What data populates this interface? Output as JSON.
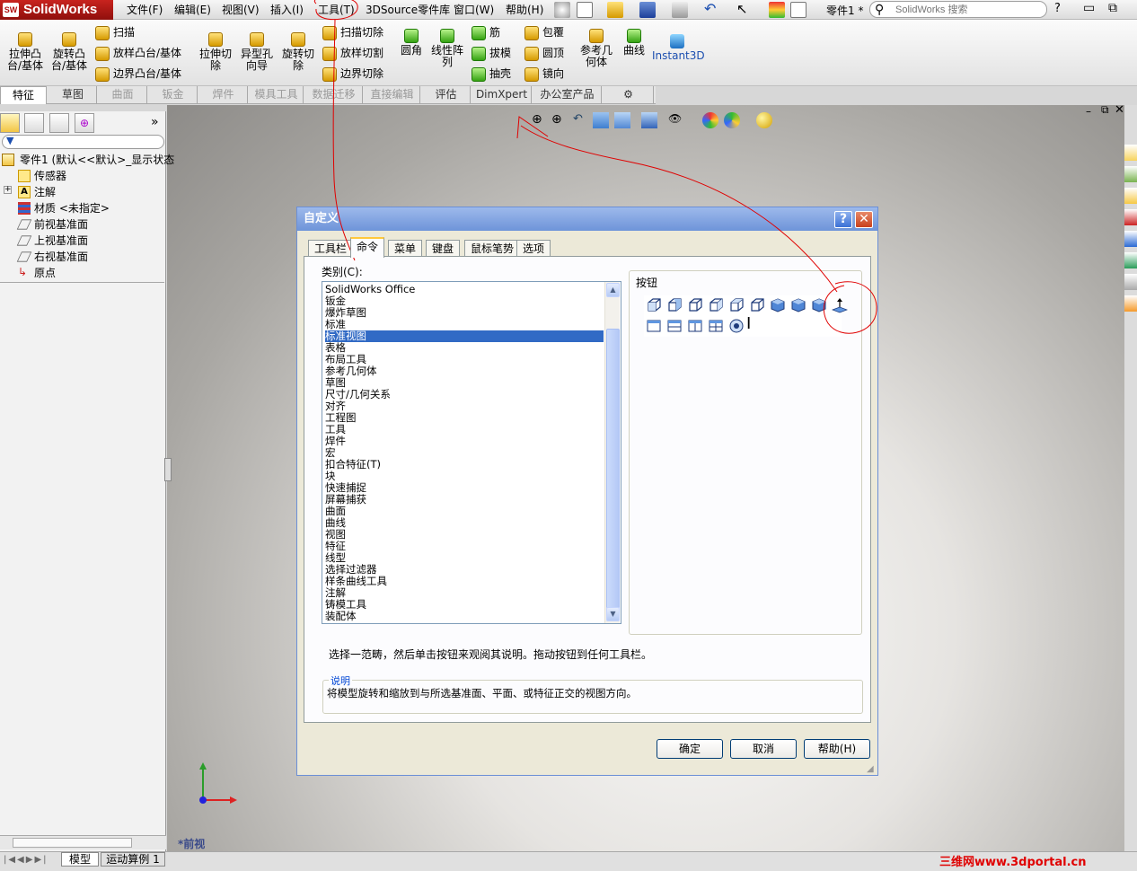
{
  "app": {
    "name": "SolidWorks",
    "doc_title": "零件1 *"
  },
  "menu": [
    "文件(F)",
    "编辑(E)",
    "视图(V)",
    "插入(I)",
    "工具(T)",
    "3DSource零件库",
    "窗口(W)",
    "帮助(H)"
  ],
  "search": {
    "placeholder": "SolidWorks 搜索"
  },
  "ribbon": {
    "extrude_boss": "拉伸凸\n台/基体",
    "revolve_boss": "旋转凸\n台/基体",
    "sweep": "扫描",
    "loft_boss": "放样凸台/基体",
    "boundary_boss": "边界凸台/基体",
    "extrude_cut": "拉伸切\n除",
    "hole_wizard": "异型孔\n向导",
    "revolve_cut": "旋转切\n除",
    "sweep_cut": "扫描切除",
    "loft_cut": "放样切割",
    "boundary_cut": "边界切除",
    "fillet": "圆角",
    "linear_pattern": "线性阵\n列",
    "rib": "筋",
    "draft": "拔模",
    "shell": "抽壳",
    "wrap": "包覆",
    "dome": "圆顶",
    "mirror": "镜向",
    "ref_geometry": "参考几\n何体",
    "curves": "曲线",
    "instant3d": "Instant3D"
  },
  "tabs": [
    "特征",
    "草图",
    "曲面",
    "钣金",
    "焊件",
    "模具工具",
    "数据迁移",
    "直接编辑",
    "评估",
    "DimXpert",
    "办公室产品"
  ],
  "tree": {
    "root": "零件1  (默认<<默认>_显示状态",
    "items": [
      "传感器",
      "注解",
      "材质 <未指定>",
      "前视基准面",
      "上视基准面",
      "右视基准面",
      "原点"
    ]
  },
  "viewport": {
    "view_label": "*前视"
  },
  "bottom_tabs": [
    "模型",
    "运动算例 1"
  ],
  "watermark": "三维网www.3dportal.cn",
  "dialog": {
    "title": "自定义",
    "help_btn": "?",
    "close_btn": "✕",
    "tabs": [
      "工具栏",
      "命令",
      "菜单",
      "键盘",
      "鼠标笔势",
      "选项"
    ],
    "category_label": "类别(C):",
    "categories": [
      "SolidWorks Office",
      "钣金",
      "爆炸草图",
      "标准",
      "标准视图",
      "表格",
      "布局工具",
      "参考几何体",
      "草图",
      "尺寸/几何关系",
      "对齐",
      "工程图",
      "工具",
      "焊件",
      "宏",
      "扣合特征(T)",
      "块",
      "快速捕捉",
      "屏幕捕获",
      "曲面",
      "曲线",
      "视图",
      "特征",
      "线型",
      "选择过滤器",
      "样条曲线工具",
      "注解",
      "铸模工具",
      "装配体"
    ],
    "selected_category": "标准视图",
    "buttons_label": "按钮",
    "hint": "选择一范畴，然后单击按钮来观阅其说明。拖动按钮到任何工具栏。",
    "desc_label": "说明",
    "desc_text": "将模型旋转和缩放到与所选基准面、平面、或特征正交的视图方向。",
    "ok": "确定",
    "cancel": "取消",
    "help": "帮助(H)"
  },
  "colors": {
    "accent": "#316ac5",
    "annotation": "#e00000",
    "title_gradient": "#6e94d9"
  }
}
